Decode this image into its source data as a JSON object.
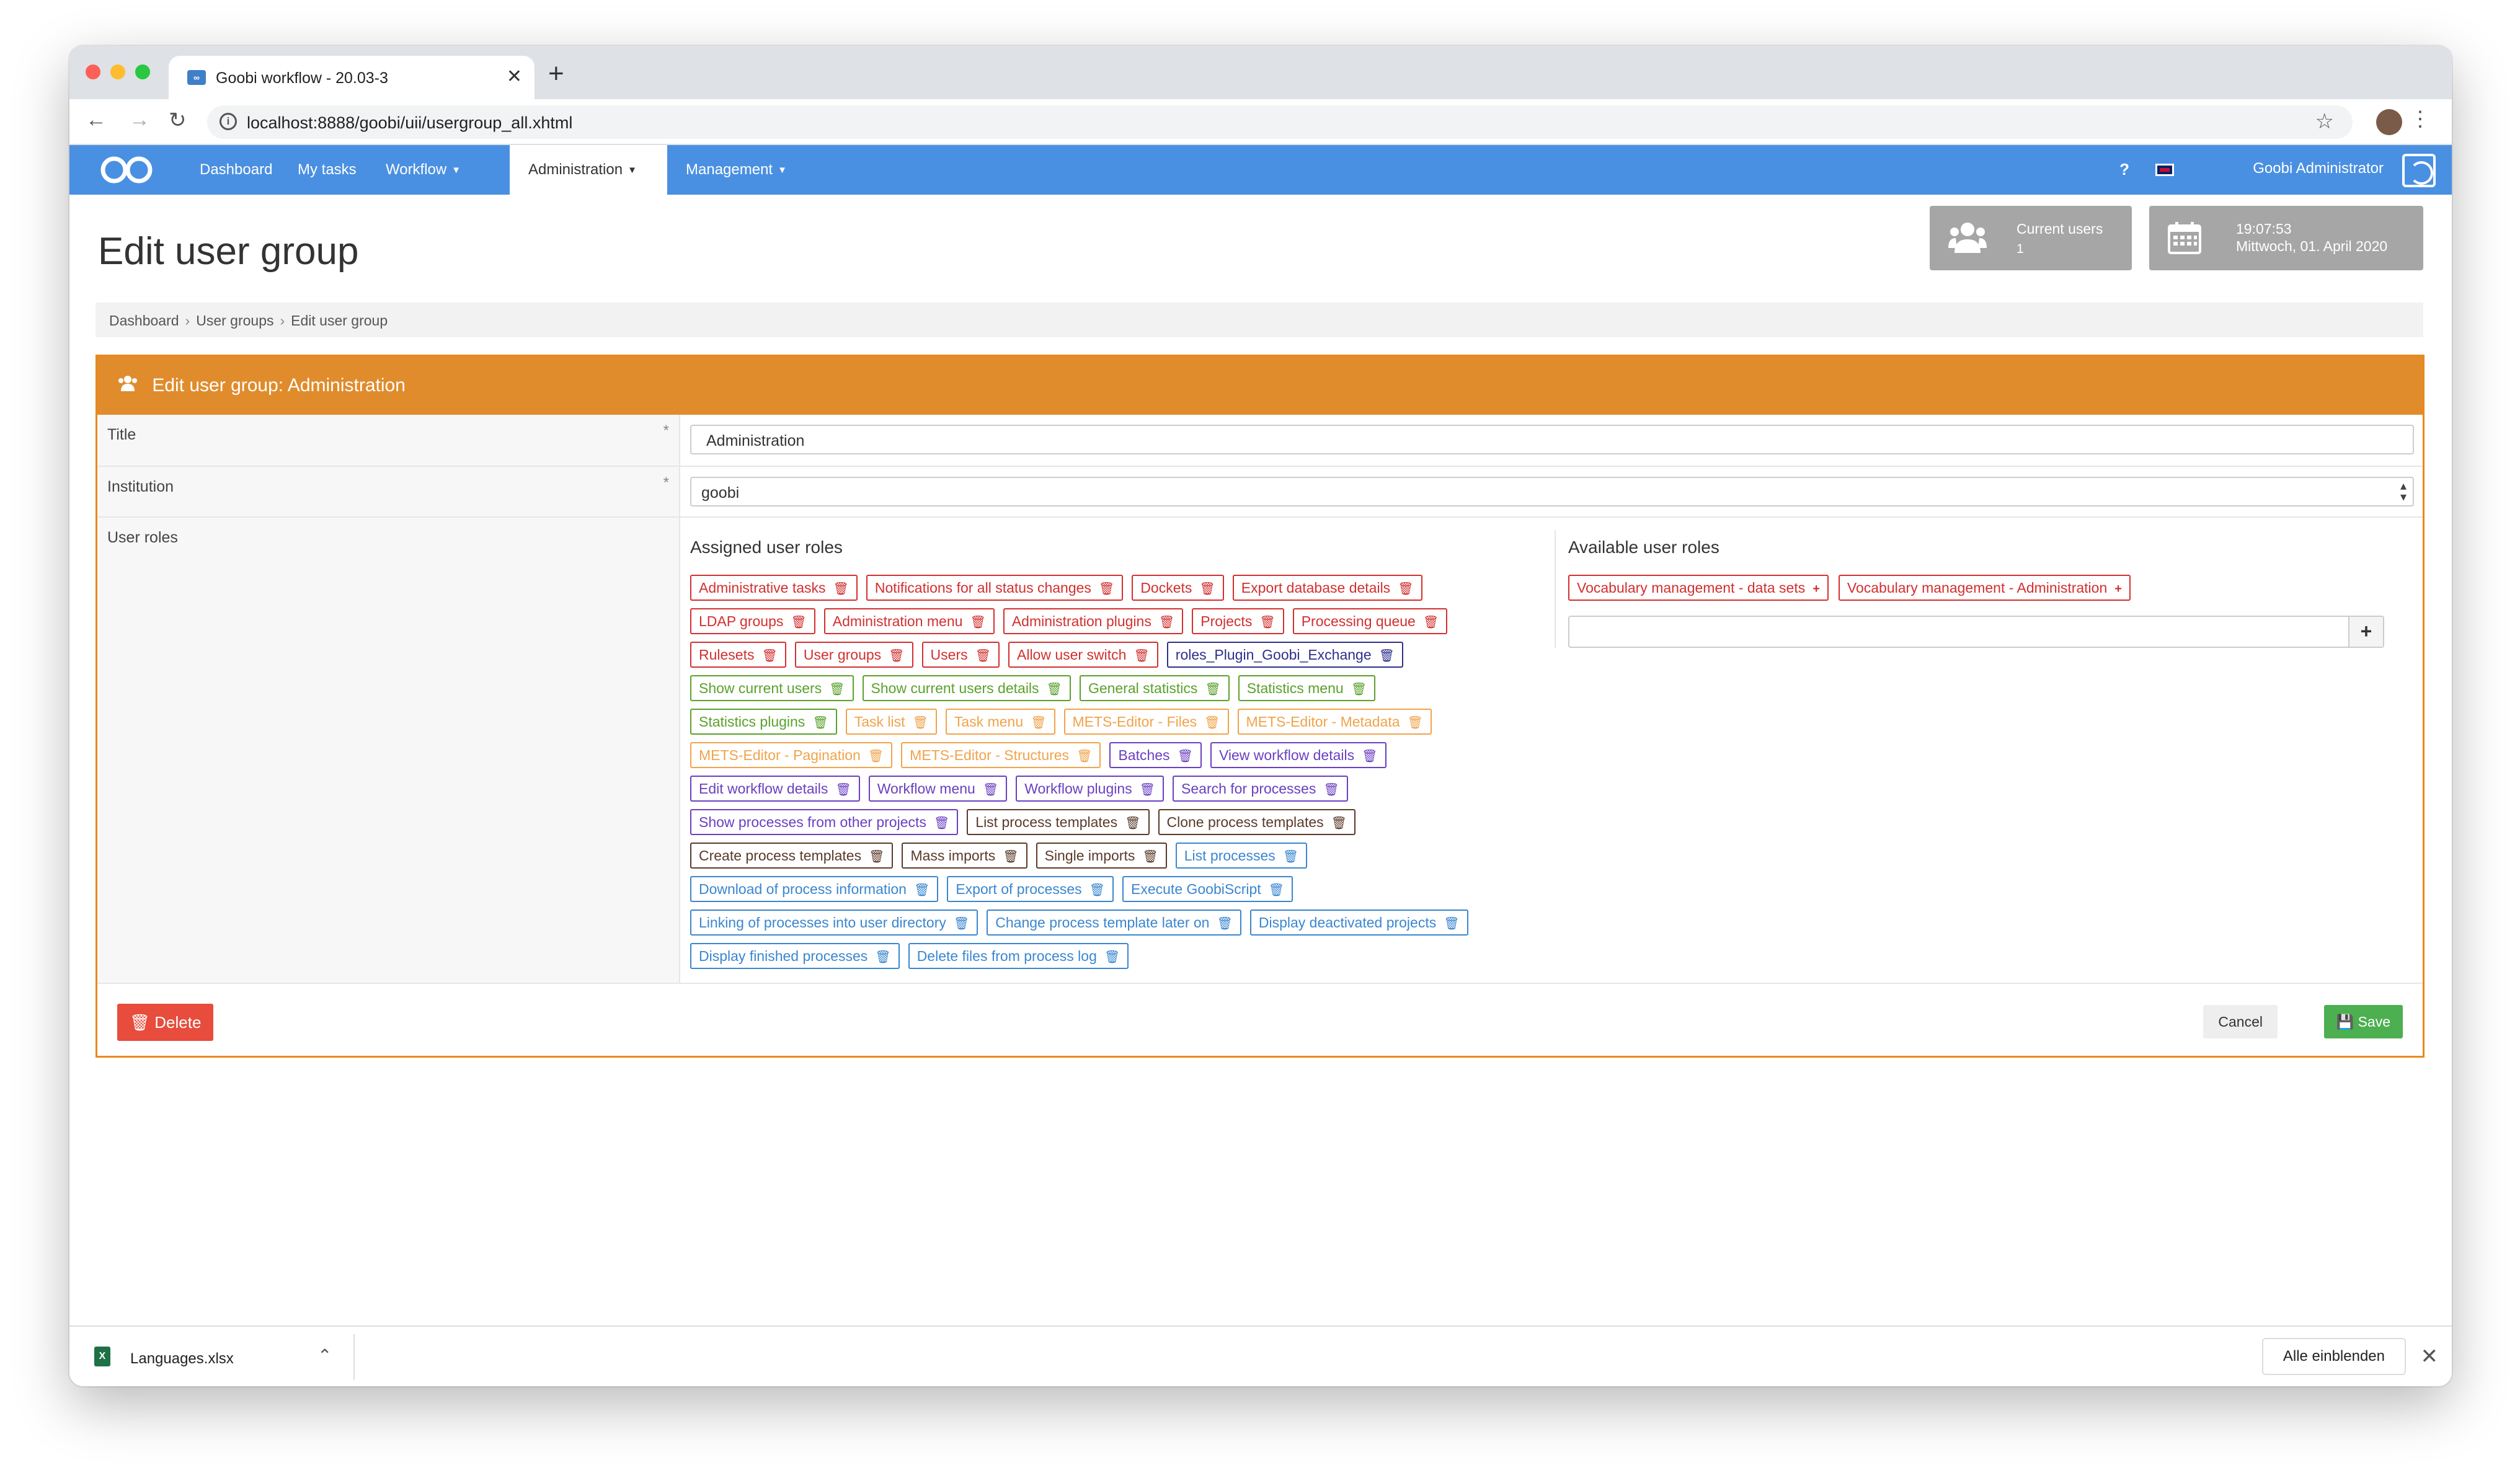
{
  "browser": {
    "tab_title": "Goobi workflow - 20.03-3",
    "favicon": "∞",
    "url": "localhost:8888/goobi/uii/usergroup_all.xhtml"
  },
  "nav": {
    "items": [
      "Dashboard",
      "My tasks",
      "Workflow",
      "Administration",
      "Management"
    ],
    "help": "?",
    "user": "Goobi Administrator"
  },
  "page": {
    "title": "Edit user group",
    "widgets": {
      "users_label": "Current users",
      "users_value": "1",
      "time": "19:07:53",
      "date": "Mittwoch, 01. April 2020"
    },
    "breadcrumb": [
      "Dashboard",
      "User groups",
      "Edit user group"
    ]
  },
  "form": {
    "heading": "Edit user group: Administration",
    "title_label": "Title",
    "title_value": "Administration",
    "institution_label": "Institution",
    "institution_value": "goobi",
    "roles_label": "User roles",
    "required": "*",
    "assigned_heading": "Assigned user roles",
    "available_heading": "Available user roles",
    "add_button": "+",
    "assigned_roles": [
      [
        {
          "label": "Administrative tasks",
          "color": "red"
        },
        {
          "label": "Notifications for all status changes",
          "color": "red"
        },
        {
          "label": "Dockets",
          "color": "red"
        },
        {
          "label": "Export database details",
          "color": "red"
        }
      ],
      [
        {
          "label": "LDAP groups",
          "color": "red"
        },
        {
          "label": "Administration menu",
          "color": "red"
        },
        {
          "label": "Administration plugins",
          "color": "red"
        },
        {
          "label": "Projects",
          "color": "red"
        },
        {
          "label": "Processing queue",
          "color": "red"
        }
      ],
      [
        {
          "label": "Rulesets",
          "color": "red"
        },
        {
          "label": "User groups",
          "color": "red"
        },
        {
          "label": "Users",
          "color": "red"
        },
        {
          "label": "Allow user switch",
          "color": "red"
        },
        {
          "label": "roles_Plugin_Goobi_Exchange",
          "color": "navy"
        }
      ],
      [
        {
          "label": "Show current users",
          "color": "green"
        },
        {
          "label": "Show current users details",
          "color": "green"
        },
        {
          "label": "General statistics",
          "color": "green"
        },
        {
          "label": "Statistics menu",
          "color": "green"
        }
      ],
      [
        {
          "label": "Statistics plugins",
          "color": "green"
        },
        {
          "label": "Task list",
          "color": "orange"
        },
        {
          "label": "Task menu",
          "color": "orange"
        },
        {
          "label": "METS-Editor - Files",
          "color": "orange"
        },
        {
          "label": "METS-Editor - Metadata",
          "color": "orange"
        }
      ],
      [
        {
          "label": "METS-Editor - Pagination",
          "color": "orange"
        },
        {
          "label": "METS-Editor - Structures",
          "color": "orange"
        },
        {
          "label": "Batches",
          "color": "purple"
        },
        {
          "label": "View workflow details",
          "color": "purple"
        }
      ],
      [
        {
          "label": "Edit workflow details",
          "color": "purple"
        },
        {
          "label": "Workflow menu",
          "color": "purple"
        },
        {
          "label": "Workflow plugins",
          "color": "purple"
        },
        {
          "label": "Search for processes",
          "color": "purple"
        }
      ],
      [
        {
          "label": "Show processes from other projects",
          "color": "purple"
        },
        {
          "label": "List process templates",
          "color": "brown"
        },
        {
          "label": "Clone process templates",
          "color": "brown"
        }
      ],
      [
        {
          "label": "Create process templates",
          "color": "brown"
        },
        {
          "label": "Mass imports",
          "color": "brown"
        },
        {
          "label": "Single imports",
          "color": "brown"
        },
        {
          "label": "List processes",
          "color": "blue"
        }
      ],
      [
        {
          "label": "Download of process information",
          "color": "blue"
        },
        {
          "label": "Export of processes",
          "color": "blue"
        },
        {
          "label": "Execute GoobiScript",
          "color": "blue"
        }
      ],
      [
        {
          "label": "Linking of processes into user directory",
          "color": "blue"
        },
        {
          "label": "Change process template later on",
          "color": "blue"
        },
        {
          "label": "Display deactivated projects",
          "color": "blue"
        }
      ],
      [
        {
          "label": "Display finished processes",
          "color": "blue"
        },
        {
          "label": "Delete files from process log",
          "color": "blue"
        }
      ]
    ],
    "available_roles": [
      {
        "label": "Vocabulary management - data sets",
        "color": "red"
      },
      {
        "label": "Vocabulary management - Administration",
        "color": "red"
      }
    ],
    "delete_label": "Delete",
    "cancel_label": "Cancel",
    "save_label": "Save"
  },
  "downloads": {
    "file": "Languages.xlsx",
    "show_all": "Alle einblenden"
  }
}
